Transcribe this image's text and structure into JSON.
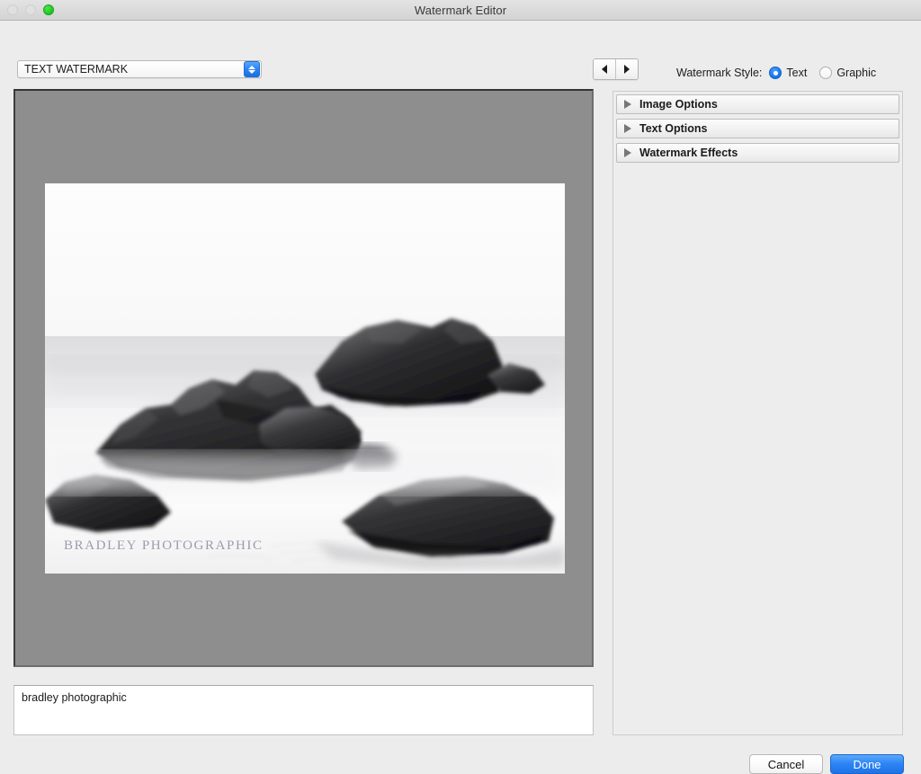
{
  "window": {
    "title": "Watermark Editor",
    "traffic_lights": [
      {
        "name": "close",
        "state": "disabled"
      },
      {
        "name": "minimize",
        "state": "disabled"
      },
      {
        "name": "zoom",
        "state": "active",
        "color": "#28cd28"
      }
    ]
  },
  "preset_popup": {
    "value": "TEXT WATERMARK",
    "icon": "updown-chevron-icon"
  },
  "preview": {
    "background_color": "#8e8e8e",
    "watermark_overlay_text": "BRADLEY PHOTOGRAPHIC"
  },
  "text_entry": {
    "value": "bradley photographic",
    "placeholder": ""
  },
  "navigation": {
    "previous_icon": "triangle-left-icon",
    "next_icon": "triangle-right-icon"
  },
  "watermark_style": {
    "label": "Watermark Style:",
    "options": [
      {
        "label": "Text",
        "selected": true
      },
      {
        "label": "Graphic",
        "selected": false
      }
    ],
    "selected": "Text",
    "accent_color": "#1a7af0"
  },
  "option_panels": [
    {
      "label": "Image Options",
      "expanded": false,
      "icon": "disclosure-triangle-icon"
    },
    {
      "label": "Text Options",
      "expanded": false,
      "icon": "disclosure-triangle-icon"
    },
    {
      "label": "Watermark Effects",
      "expanded": false,
      "icon": "disclosure-triangle-icon"
    }
  ],
  "footer": {
    "cancel_label": "Cancel",
    "done_label": "Done",
    "done_accent_color": "#2d84f4"
  }
}
